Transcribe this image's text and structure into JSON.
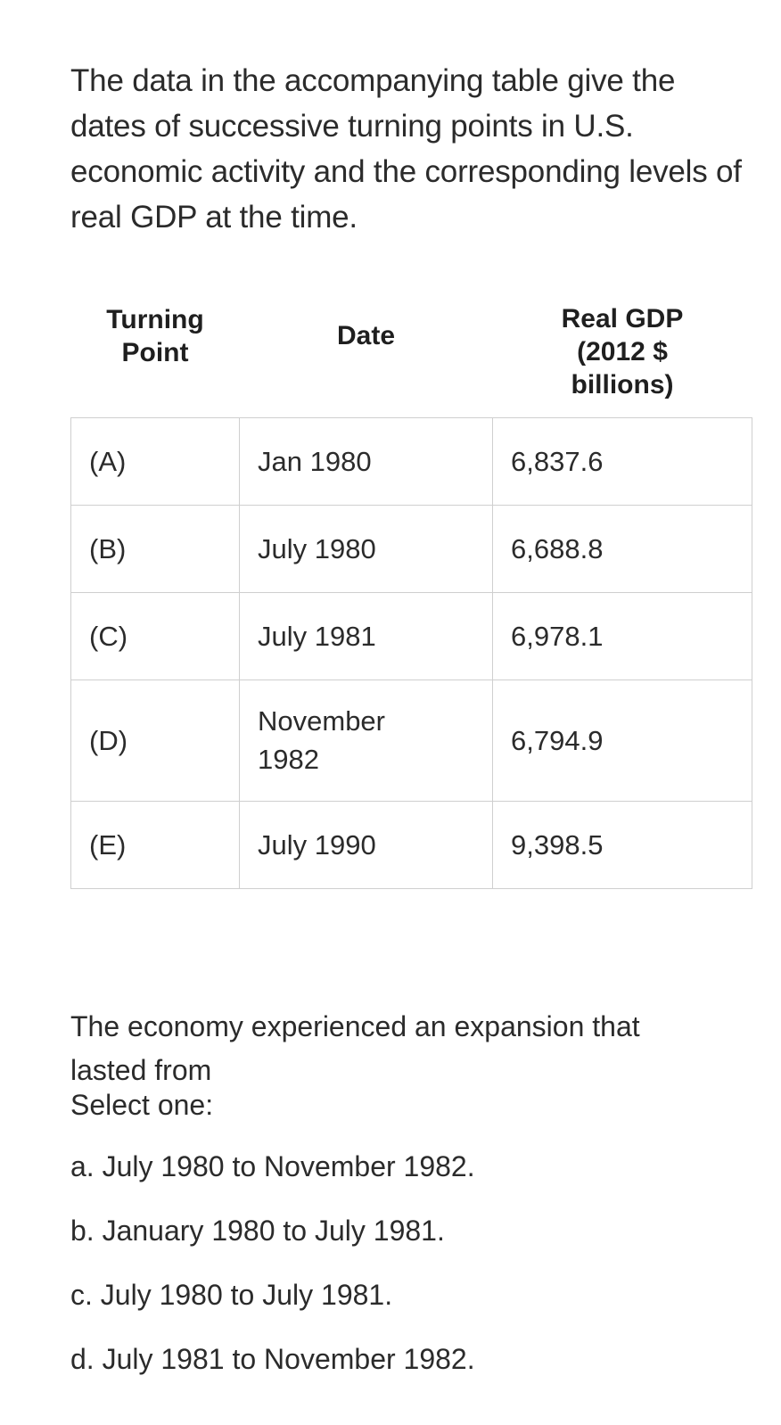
{
  "intro": {
    "text": "The data in the accompanying table give the dates of successive turning points in U.S. economic activity and the corresponding levels of real GDP at the time."
  },
  "table": {
    "headers": {
      "turning_point_line1": "Turning",
      "turning_point_line2": "Point",
      "date": "Date",
      "real_gdp_line1": "Real GDP",
      "real_gdp_line2": "(2012 $",
      "real_gdp_line3": "billions)"
    },
    "rows": [
      {
        "point": "(A)",
        "date": "Jan 1980",
        "date_line1": "Jan 1980",
        "date_line2": "",
        "gdp": "6,837.6"
      },
      {
        "point": "(B)",
        "date": "July 1980",
        "date_line1": "July 1980",
        "date_line2": "",
        "gdp": "6,688.8"
      },
      {
        "point": "(C)",
        "date": "July 1981",
        "date_line1": "July 1981",
        "date_line2": "",
        "gdp": "6,978.1"
      },
      {
        "point": "(D)",
        "date": "November 1982",
        "date_line1": "November",
        "date_line2": "1982",
        "gdp": "6,794.9"
      },
      {
        "point": "(E)",
        "date": "July 1990",
        "date_line1": "July 1990",
        "date_line2": "",
        "gdp": "9,398.5"
      }
    ]
  },
  "question": {
    "prompt": "The economy experienced an expansion that lasted from",
    "select_label": "Select one:",
    "options": [
      "a. July 1980 to November 1982.",
      "b. January 1980 to July 1981.",
      "c. July 1980 to July 1981.",
      "d. July 1981 to November 1982."
    ]
  },
  "colors": {
    "text": "#2b2b2b",
    "header_text": "#1f1f1f",
    "table_border": "#cfcfcf",
    "background": "#ffffff"
  },
  "chart_data": {
    "type": "table",
    "title": "U.S. economic activity turning points and real GDP",
    "columns": [
      "Turning Point",
      "Date",
      "Real GDP (2012 $ billions)"
    ],
    "rows": [
      [
        "(A)",
        "Jan 1980",
        6837.6
      ],
      [
        "(B)",
        "July 1980",
        6688.8
      ],
      [
        "(C)",
        "July 1981",
        6978.1
      ],
      [
        "(D)",
        "November 1982",
        6794.9
      ],
      [
        "(E)",
        "July 1990",
        9398.5
      ]
    ],
    "categories": [
      "Jan 1980",
      "July 1980",
      "July 1981",
      "November 1982",
      "July 1990"
    ],
    "values": [
      6837.6,
      6688.8,
      6978.1,
      6794.9,
      9398.5
    ],
    "xlabel": "Date",
    "ylabel": "Real GDP (2012 $ billions)"
  }
}
